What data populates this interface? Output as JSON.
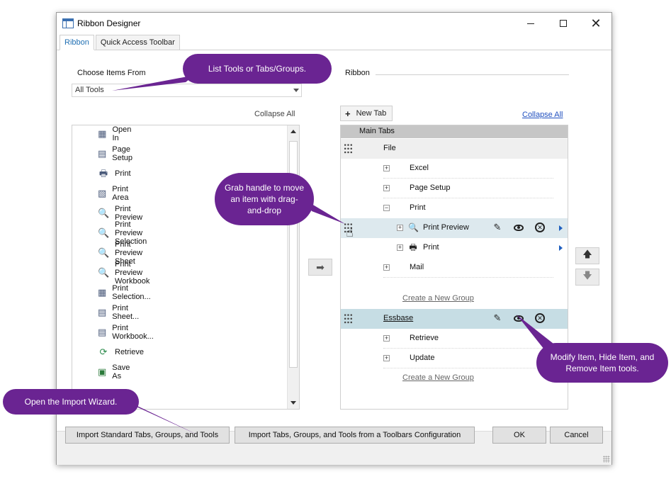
{
  "window": {
    "title": "Ribbon Designer"
  },
  "tabs": [
    {
      "label": "Ribbon",
      "active": true
    },
    {
      "label": "Quick Access Toolbar",
      "active": false
    }
  ],
  "choose": {
    "label": "Choose Items From",
    "selected": "All Tools",
    "collapse_all": "Collapse All"
  },
  "left_items": [
    {
      "label": "Open In",
      "icon": "open-in-icon"
    },
    {
      "label": "Page Setup",
      "icon": "page-setup-icon"
    },
    {
      "label": "Print",
      "icon": "printer-icon"
    },
    {
      "label": "Print Area",
      "icon": "print-area-icon"
    },
    {
      "label": "Print Preview",
      "icon": "print-preview-icon"
    },
    {
      "label": "Print Preview Selection",
      "icon": "print-preview-selection-icon"
    },
    {
      "label": "Print Preview Sheet",
      "icon": "print-preview-sheet-icon"
    },
    {
      "label": "Print Preview Workbook",
      "icon": "print-preview-workbook-icon"
    },
    {
      "label": "Print Selection...",
      "icon": "print-selection-icon"
    },
    {
      "label": "Print Sheet...",
      "icon": "print-sheet-icon"
    },
    {
      "label": "Print Workbook...",
      "icon": "print-workbook-icon"
    },
    {
      "label": "Retrieve",
      "icon": "retrieve-icon"
    },
    {
      "label": "Save As",
      "icon": "save-as-icon"
    }
  ],
  "ribbon": {
    "label": "Ribbon",
    "new_tab": "New Tab",
    "collapse_all": "Collapse All",
    "main_tabs": "Main Tabs",
    "file_tab": "File",
    "file_groups": {
      "excel": "Excel",
      "page_setup": "Page Setup",
      "print": "Print",
      "print_preview": "Print Preview",
      "print_tool": "Print",
      "mail": "Mail"
    },
    "create_new_group": "Create a New Group",
    "essbase_tab": "Essbase",
    "essbase_groups": {
      "retrieve": "Retrieve",
      "update": "Update"
    }
  },
  "buttons": {
    "import_standard": "Import Standard Tabs, Groups, and Tools",
    "import_toolbars": "Import Tabs, Groups, and Tools from a Toolbars Configuration",
    "ok": "OK",
    "cancel": "Cancel"
  },
  "callouts": {
    "list_tools": "List Tools or Tabs/Groups.",
    "grab_handle": "Grab handle to move an item with drag-and-drop",
    "modify_tools": "Modify Item, Hide Item, and Remove Item tools.",
    "import_wizard": "Open the Import Wizard."
  },
  "colors": {
    "callout": "#6a2492",
    "selected_row": "#dde9ee",
    "essbase_row": "#c6dde4",
    "link": "#1f4fbf"
  }
}
